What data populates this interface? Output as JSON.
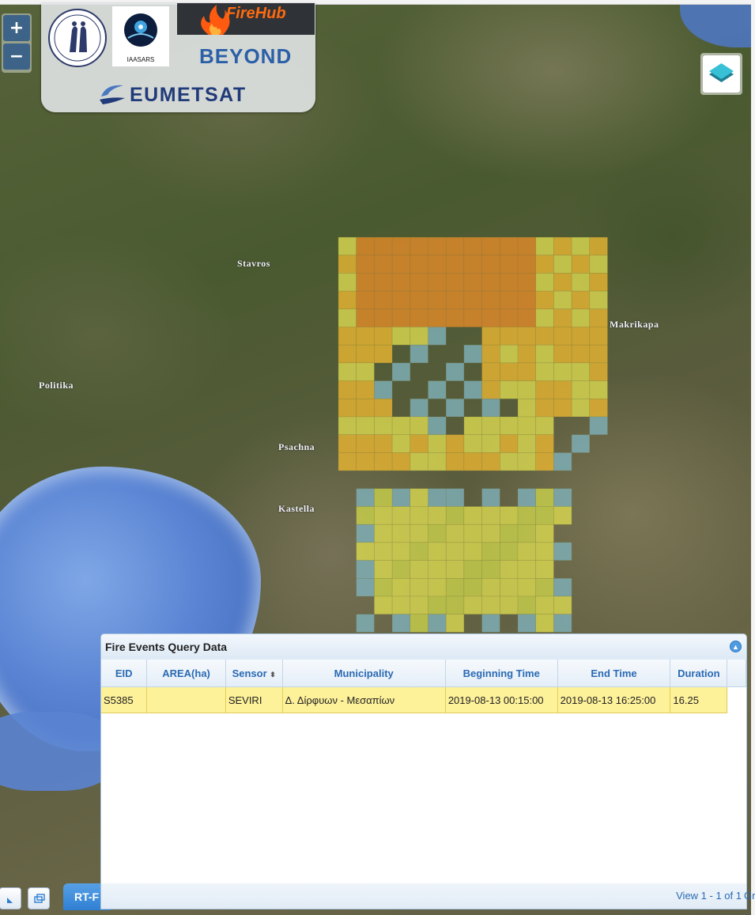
{
  "map": {
    "places": [
      {
        "name": "Stavros"
      },
      {
        "name": "Makrikapa"
      },
      {
        "name": "Politika"
      },
      {
        "name": "Psachna"
      },
      {
        "name": "Kastella"
      }
    ],
    "fire_colors": {
      "high": "#e08a2a",
      "mid": "#e6b432",
      "low": "#d9d850",
      "edge": "#7fb0b8"
    }
  },
  "controls": {
    "zoom_in": "+",
    "zoom_out": "−",
    "layers_icon": "layers-icon"
  },
  "logos": {
    "iaasars": "IAASARS",
    "firehub": "FireHub",
    "beyond": "BEYOND",
    "eumetsat": "EUMETSAT"
  },
  "taskbar": {
    "tab_label": "RT-F"
  },
  "panel": {
    "title": "Fire Events Query Data",
    "columns": [
      "EID",
      "AREA(ha)",
      "Sensor",
      "Municipality",
      "Beginning Time",
      "End Time",
      "Duration"
    ],
    "rows": [
      {
        "eid": "S5385",
        "area": "",
        "sensor": "SEVIRI",
        "municipality": "Δ. Δίρφυων - Μεσαπίων",
        "begin": "2019-08-13 00:15:00",
        "end": "2019-08-13 16:25:00",
        "duration": "16.25"
      }
    ],
    "footer": "View 1 - 1 of 1",
    "footer_cut": "Gr"
  }
}
